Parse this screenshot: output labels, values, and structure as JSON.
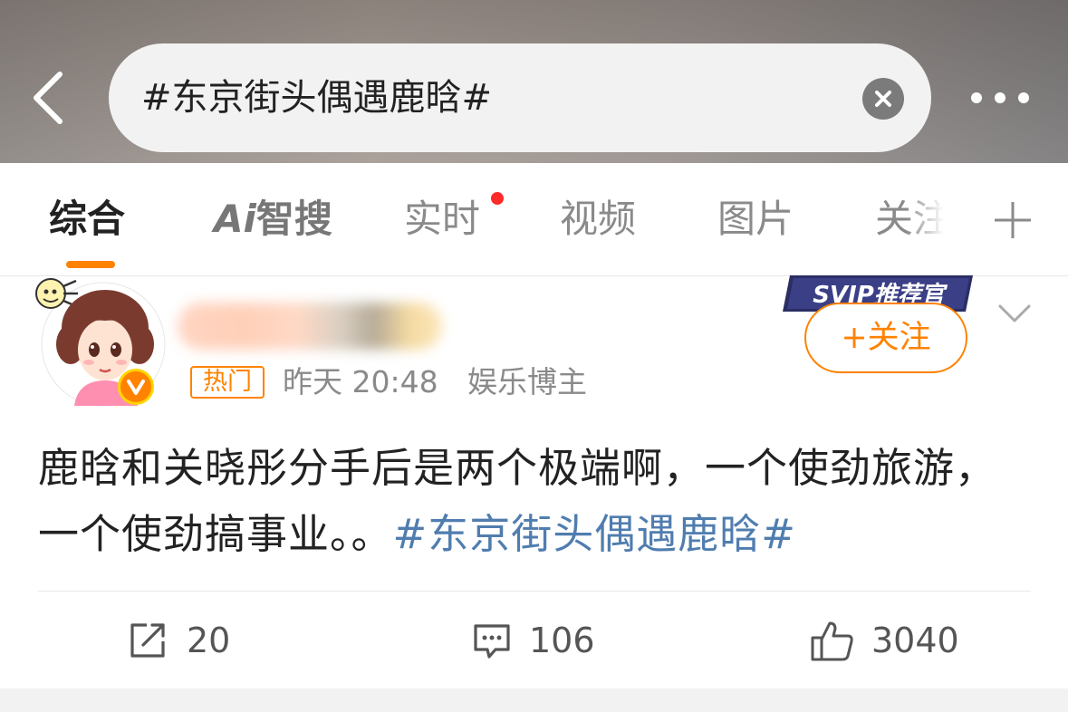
{
  "header": {
    "search_query": "#东京街头偶遇鹿晗#"
  },
  "tabs": [
    {
      "label": "综合"
    },
    {
      "label": "智搜",
      "ai_mark": "Ai"
    },
    {
      "label": "实时",
      "has_red_dot": true
    },
    {
      "label": "视频"
    },
    {
      "label": "图片"
    },
    {
      "label": "关注"
    }
  ],
  "post": {
    "hot_badge": "热门",
    "time": "昨天 20:48",
    "source": "娱乐博主",
    "svip_badge": "SVIP推荐官",
    "follow_label": "+关注",
    "content_text": "鹿晗和关晓彤分手后是两个极端啊，一个使劲旅游，一个使劲搞事业。。",
    "hashtag": "#东京街头偶遇鹿晗#",
    "repost_count": "20",
    "comment_count": "106",
    "like_count": "3040"
  },
  "colors": {
    "accent": "#ff8200",
    "hashtag": "#507daf",
    "red_dot": "#ff2a2a",
    "text_primary": "#222222",
    "text_secondary": "#8a8a8a"
  }
}
